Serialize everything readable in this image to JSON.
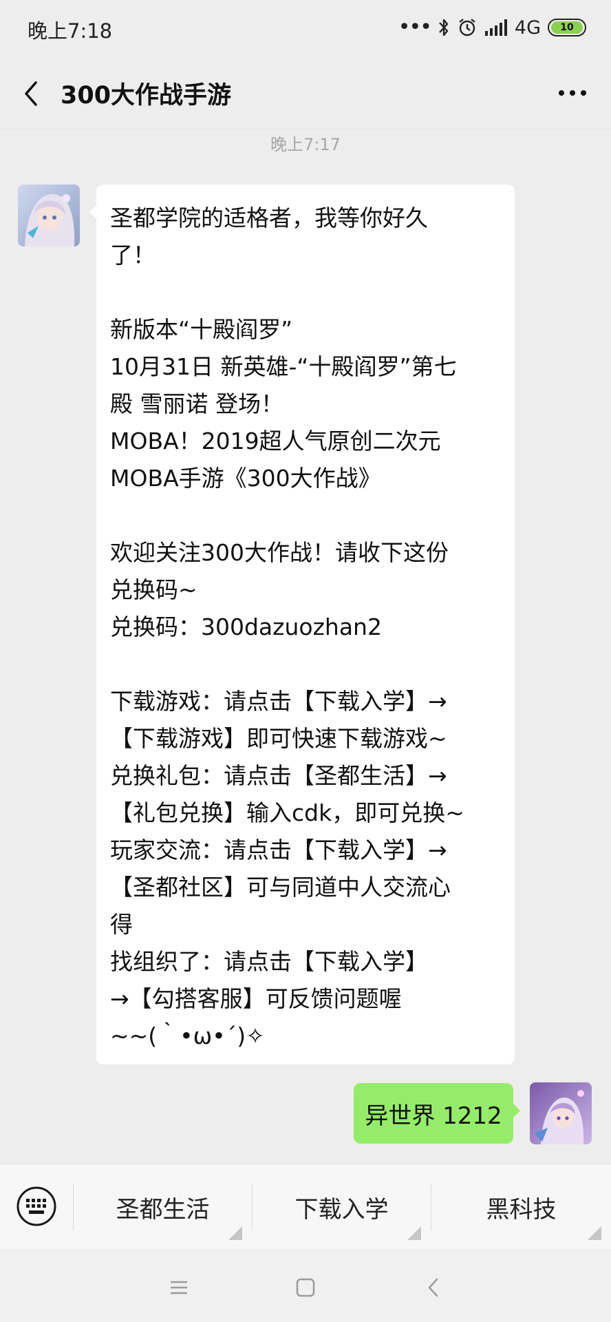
{
  "status_bar": {
    "time": "晚上7:18",
    "network": "4G",
    "battery": "10",
    "icons": [
      "more-dots-icon",
      "bluetooth-icon",
      "alarm-icon",
      "signal-icon",
      "battery-icon"
    ],
    "battery_color": "#8ad151"
  },
  "header": {
    "title": "300大作战手游",
    "back_icon": "chevron-left-icon",
    "more_icon": "more-horizontal-icon"
  },
  "conversation": {
    "timestamp": "晚上7:17",
    "incoming": {
      "lines": [
        "圣都学院的适格者，我等你好久",
        "了！",
        "",
        "新版本“十殿阎罗”",
        "10月31日 新英雄-“十殿阎罗”第七",
        "殿 雪丽诺 登场！",
        "MOBA！2019超人气原创二次元",
        "MOBA手游《300大作战》",
        "",
        "欢迎关注300大作战！请收下这份",
        "兑换码~",
        "兑换码：300dazuozhan2",
        "",
        "下载游戏：请点击【下载入学】→",
        "【下载游戏】即可快速下载游戏~",
        "兑换礼包：请点击【圣都生活】→",
        "【礼包兑换】输入cdk，即可兑换~",
        "玩家交流：请点击【下载入学】→",
        "【圣都社区】可与同道中人交流心",
        "得",
        "找组织了：请点击【下载入学】",
        "→【勾搭客服】可反馈问题喔",
        "~~(｀•ω•´)✧"
      ]
    },
    "outgoing": {
      "text": "异世界 1212",
      "bubble_color": "#95ec69"
    }
  },
  "menu": {
    "keyboard_icon": "keyboard-icon",
    "items": [
      {
        "label": "圣都生活"
      },
      {
        "label": "下载入学"
      },
      {
        "label": "黑科技"
      }
    ]
  },
  "system_nav": {
    "icons": [
      "menu-icon",
      "home-square-icon",
      "back-icon"
    ]
  }
}
